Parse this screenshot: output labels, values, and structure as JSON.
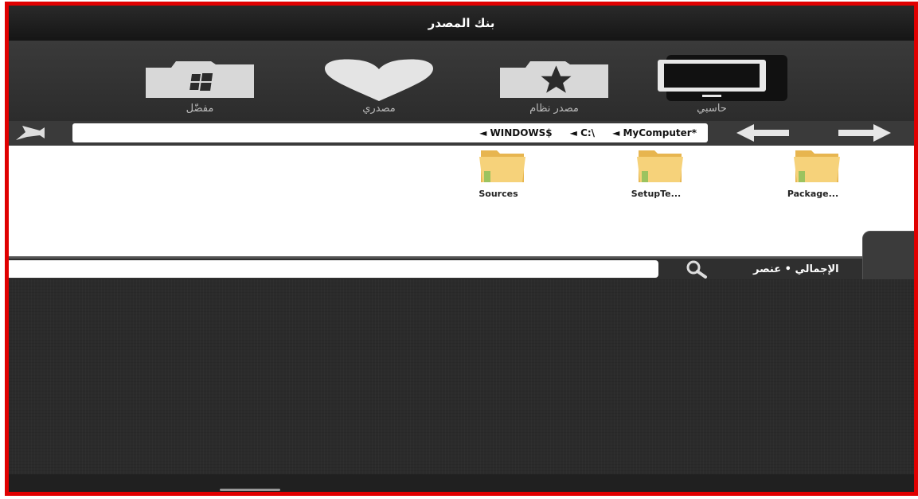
{
  "window": {
    "title": "بنك المصدر"
  },
  "categories": [
    {
      "label": "حاسبي",
      "icon": "computer-monitor-icon",
      "active": true
    },
    {
      "label": "مصدر نظام",
      "icon": "star-folder-icon"
    },
    {
      "label": "مصدري",
      "icon": "heart-icon"
    },
    {
      "label": "مفضّل",
      "icon": "windows-folder-icon"
    }
  ],
  "path": {
    "crumbs": [
      "◄ WINDOWS$",
      "◄ C:\\",
      "◄ MyComputer*"
    ]
  },
  "files": [
    {
      "name": "Package...",
      "icon": "folder-icon"
    },
    {
      "name": "SetupTe...",
      "icon": "folder-icon"
    },
    {
      "name": "Sources",
      "icon": "folder-icon"
    }
  ],
  "status": {
    "total": "الإجمالي • عنصر"
  },
  "search": {
    "placeholder": ""
  },
  "colors": {
    "frame_border": "#e00000",
    "folder": "#f1c868"
  }
}
